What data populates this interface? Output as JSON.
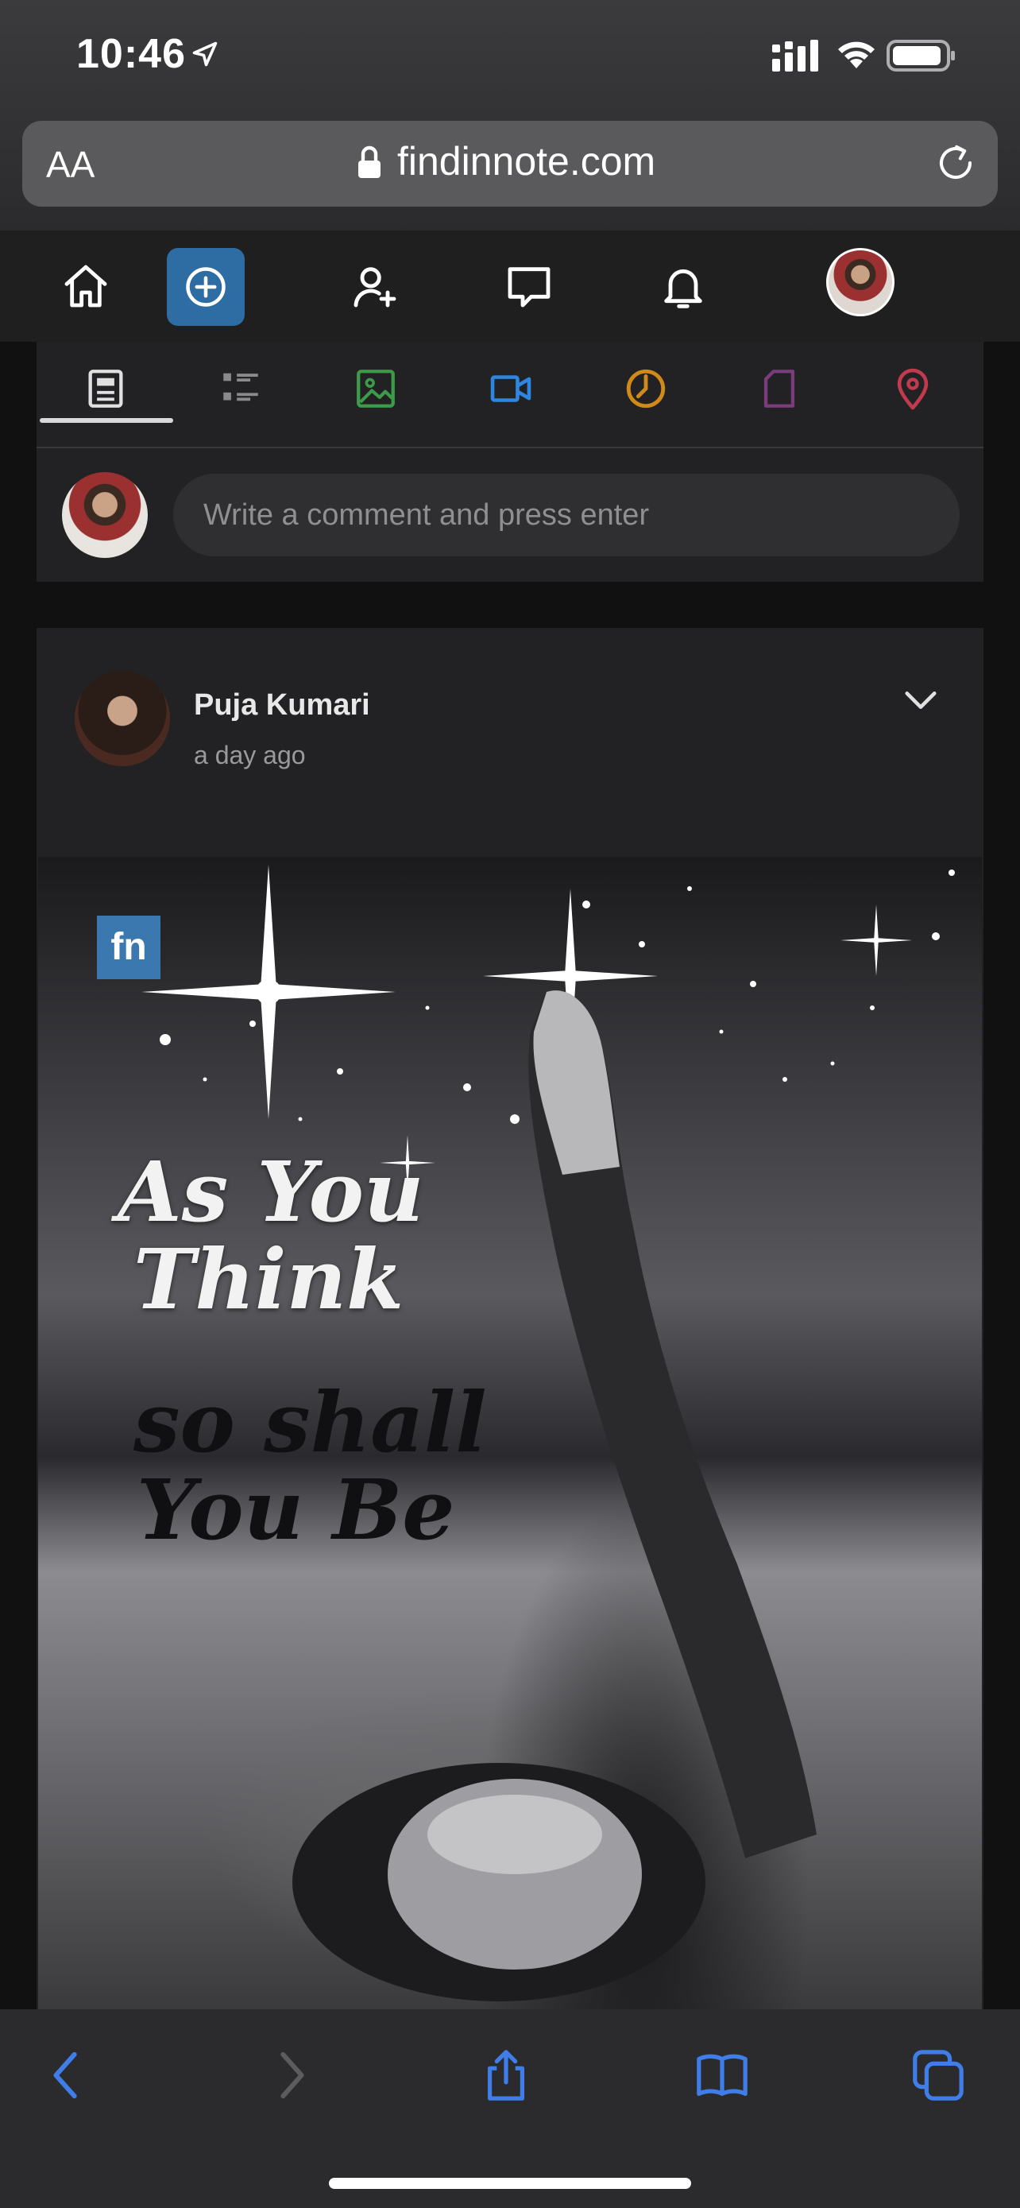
{
  "status_bar": {
    "time": "10:46"
  },
  "browser": {
    "text_size_label": "AA",
    "url": "findinnote.com"
  },
  "site_nav": {
    "icons": [
      "home-icon",
      "compose-icon",
      "add-friend-icon",
      "messages-icon",
      "notifications-icon",
      "profile-avatar"
    ]
  },
  "composer": {
    "tabs": [
      "post-icon",
      "list-icon",
      "image-icon",
      "video-icon",
      "poll-icon",
      "document-icon",
      "location-icon"
    ],
    "active_tab": "post-icon",
    "comment_placeholder": "Write a comment and press enter"
  },
  "post": {
    "author": "Puja Kumari",
    "time": "a day ago",
    "image": {
      "logo_text": "fn",
      "quote_line_1": "As You",
      "quote_line_2": "Think",
      "quote_line_3": "so shall",
      "quote_line_4": "You Be"
    }
  },
  "colors": {
    "accent": "#2e6da4",
    "safari_blue": "#3f7ee8",
    "tab_image": "#3d9a48",
    "tab_video": "#2f86e0",
    "tab_poll": "#d18a1a",
    "tab_document": "#7a3c7a",
    "tab_location": "#c23a4e"
  }
}
